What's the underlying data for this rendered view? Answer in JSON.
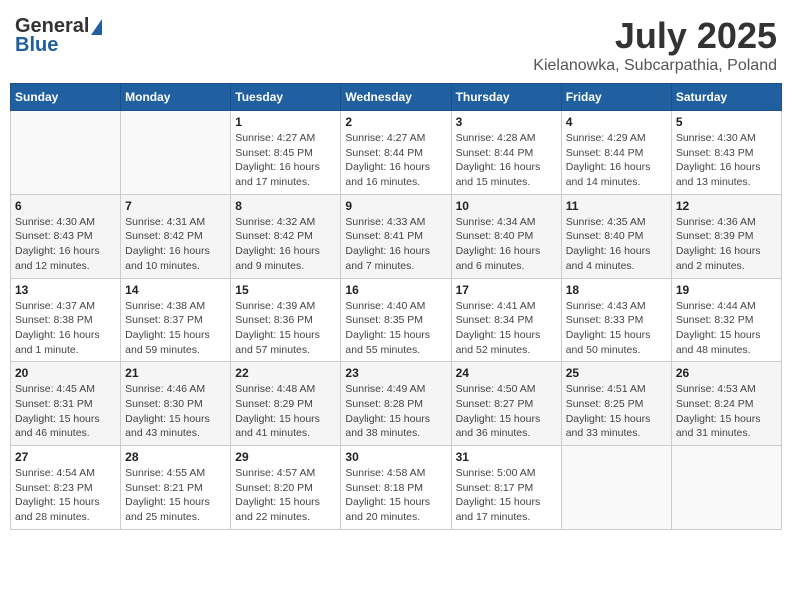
{
  "header": {
    "logo_general": "General",
    "logo_blue": "Blue",
    "month": "July 2025",
    "location": "Kielanowka, Subcarpathia, Poland"
  },
  "weekdays": [
    "Sunday",
    "Monday",
    "Tuesday",
    "Wednesday",
    "Thursday",
    "Friday",
    "Saturday"
  ],
  "weeks": [
    [
      {
        "day": "",
        "info": ""
      },
      {
        "day": "",
        "info": ""
      },
      {
        "day": "1",
        "info": "Sunrise: 4:27 AM\nSunset: 8:45 PM\nDaylight: 16 hours and 17 minutes."
      },
      {
        "day": "2",
        "info": "Sunrise: 4:27 AM\nSunset: 8:44 PM\nDaylight: 16 hours and 16 minutes."
      },
      {
        "day": "3",
        "info": "Sunrise: 4:28 AM\nSunset: 8:44 PM\nDaylight: 16 hours and 15 minutes."
      },
      {
        "day": "4",
        "info": "Sunrise: 4:29 AM\nSunset: 8:44 PM\nDaylight: 16 hours and 14 minutes."
      },
      {
        "day": "5",
        "info": "Sunrise: 4:30 AM\nSunset: 8:43 PM\nDaylight: 16 hours and 13 minutes."
      }
    ],
    [
      {
        "day": "6",
        "info": "Sunrise: 4:30 AM\nSunset: 8:43 PM\nDaylight: 16 hours and 12 minutes."
      },
      {
        "day": "7",
        "info": "Sunrise: 4:31 AM\nSunset: 8:42 PM\nDaylight: 16 hours and 10 minutes."
      },
      {
        "day": "8",
        "info": "Sunrise: 4:32 AM\nSunset: 8:42 PM\nDaylight: 16 hours and 9 minutes."
      },
      {
        "day": "9",
        "info": "Sunrise: 4:33 AM\nSunset: 8:41 PM\nDaylight: 16 hours and 7 minutes."
      },
      {
        "day": "10",
        "info": "Sunrise: 4:34 AM\nSunset: 8:40 PM\nDaylight: 16 hours and 6 minutes."
      },
      {
        "day": "11",
        "info": "Sunrise: 4:35 AM\nSunset: 8:40 PM\nDaylight: 16 hours and 4 minutes."
      },
      {
        "day": "12",
        "info": "Sunrise: 4:36 AM\nSunset: 8:39 PM\nDaylight: 16 hours and 2 minutes."
      }
    ],
    [
      {
        "day": "13",
        "info": "Sunrise: 4:37 AM\nSunset: 8:38 PM\nDaylight: 16 hours and 1 minute."
      },
      {
        "day": "14",
        "info": "Sunrise: 4:38 AM\nSunset: 8:37 PM\nDaylight: 15 hours and 59 minutes."
      },
      {
        "day": "15",
        "info": "Sunrise: 4:39 AM\nSunset: 8:36 PM\nDaylight: 15 hours and 57 minutes."
      },
      {
        "day": "16",
        "info": "Sunrise: 4:40 AM\nSunset: 8:35 PM\nDaylight: 15 hours and 55 minutes."
      },
      {
        "day": "17",
        "info": "Sunrise: 4:41 AM\nSunset: 8:34 PM\nDaylight: 15 hours and 52 minutes."
      },
      {
        "day": "18",
        "info": "Sunrise: 4:43 AM\nSunset: 8:33 PM\nDaylight: 15 hours and 50 minutes."
      },
      {
        "day": "19",
        "info": "Sunrise: 4:44 AM\nSunset: 8:32 PM\nDaylight: 15 hours and 48 minutes."
      }
    ],
    [
      {
        "day": "20",
        "info": "Sunrise: 4:45 AM\nSunset: 8:31 PM\nDaylight: 15 hours and 46 minutes."
      },
      {
        "day": "21",
        "info": "Sunrise: 4:46 AM\nSunset: 8:30 PM\nDaylight: 15 hours and 43 minutes."
      },
      {
        "day": "22",
        "info": "Sunrise: 4:48 AM\nSunset: 8:29 PM\nDaylight: 15 hours and 41 minutes."
      },
      {
        "day": "23",
        "info": "Sunrise: 4:49 AM\nSunset: 8:28 PM\nDaylight: 15 hours and 38 minutes."
      },
      {
        "day": "24",
        "info": "Sunrise: 4:50 AM\nSunset: 8:27 PM\nDaylight: 15 hours and 36 minutes."
      },
      {
        "day": "25",
        "info": "Sunrise: 4:51 AM\nSunset: 8:25 PM\nDaylight: 15 hours and 33 minutes."
      },
      {
        "day": "26",
        "info": "Sunrise: 4:53 AM\nSunset: 8:24 PM\nDaylight: 15 hours and 31 minutes."
      }
    ],
    [
      {
        "day": "27",
        "info": "Sunrise: 4:54 AM\nSunset: 8:23 PM\nDaylight: 15 hours and 28 minutes."
      },
      {
        "day": "28",
        "info": "Sunrise: 4:55 AM\nSunset: 8:21 PM\nDaylight: 15 hours and 25 minutes."
      },
      {
        "day": "29",
        "info": "Sunrise: 4:57 AM\nSunset: 8:20 PM\nDaylight: 15 hours and 22 minutes."
      },
      {
        "day": "30",
        "info": "Sunrise: 4:58 AM\nSunset: 8:18 PM\nDaylight: 15 hours and 20 minutes."
      },
      {
        "day": "31",
        "info": "Sunrise: 5:00 AM\nSunset: 8:17 PM\nDaylight: 15 hours and 17 minutes."
      },
      {
        "day": "",
        "info": ""
      },
      {
        "day": "",
        "info": ""
      }
    ]
  ]
}
